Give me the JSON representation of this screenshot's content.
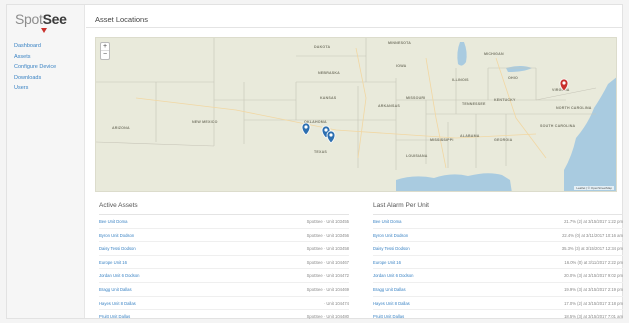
{
  "brand": {
    "name_part1": "Spot",
    "name_part2": "See"
  },
  "sidebar": {
    "items": [
      {
        "label": "Dashboard"
      },
      {
        "label": "Assets"
      },
      {
        "label": "Configure Device"
      },
      {
        "label": "Downloads"
      },
      {
        "label": "Users"
      }
    ]
  },
  "page": {
    "title": "Asset Locations"
  },
  "map": {
    "zoom_in": "+",
    "zoom_out": "−",
    "labels": [
      {
        "text": "DAKOTA"
      },
      {
        "text": "MINNESOTA"
      },
      {
        "text": "MICHIGAN"
      },
      {
        "text": "NEBRASKA"
      },
      {
        "text": "IOWA"
      },
      {
        "text": "ILLINOIS"
      },
      {
        "text": "OHIO"
      },
      {
        "text": "KENTUCKY"
      },
      {
        "text": "VIRGINIA"
      },
      {
        "text": "KANSAS"
      },
      {
        "text": "MISSOURI"
      },
      {
        "text": "OKLAHOMA"
      },
      {
        "text": "ARKANSAS"
      },
      {
        "text": "TENNESSEE"
      },
      {
        "text": "NORTH CAROLINA"
      },
      {
        "text": "SOUTH CAROLINA"
      },
      {
        "text": "NEW MEXICO"
      },
      {
        "text": "ARIZONA"
      },
      {
        "text": "TEXAS"
      },
      {
        "text": "LOUISIANA"
      },
      {
        "text": "MISSISSIPPI"
      },
      {
        "text": "ALABAMA"
      },
      {
        "text": "GEORGIA"
      }
    ],
    "attribution": "Leaflet | © OpenStreetMap"
  },
  "active_assets": {
    "title": "Active Assets",
    "rows": [
      {
        "name": "Bee Unit Doma",
        "value": "SpotSee · Unit 103455"
      },
      {
        "name": "Byron Unit Dodson",
        "value": "SpotSee · Unit 103456"
      },
      {
        "name": "Daisy Tessi Dodson",
        "value": "SpotSee · Unit 103458"
      },
      {
        "name": "Europe Unit 16",
        "value": "SpotSee · Unit 104467"
      },
      {
        "name": "Jordan Unit 6 Dodson",
        "value": "SpotSee · Unit 104472"
      },
      {
        "name": "Bragg Unit Dallas",
        "value": "SpotSee · Unit 104469"
      },
      {
        "name": "Hayes Unit 8 Dallas",
        "value": "· Unit 104474"
      },
      {
        "name": "Pruitt Unit Dallas",
        "value": "SpotSee · Unit 104480"
      }
    ]
  },
  "last_alarm": {
    "title": "Last Alarm Per Unit",
    "rows": [
      {
        "name": "Bee Unit Doma",
        "value": "21.7% (2) at 3/15/2017 1:22 pm"
      },
      {
        "name": "Byron Unit Dodson",
        "value": "22.4% (0) at 3/11/2017 10:16 am"
      },
      {
        "name": "Daisy Tessi Dodson",
        "value": "35.3% (3) at 3/15/2017 12:34 pm"
      },
      {
        "name": "Europe Unit 16",
        "value": "16.0% (0) at 3/11/2017 2:22 pm"
      },
      {
        "name": "Jordan Unit 6 Dodson",
        "value": "20.0% (3) at 3/15/2017 9:02 pm"
      },
      {
        "name": "Bragg Unit Dallas",
        "value": "19.9% (3) at 3/15/2017 2:19 pm"
      },
      {
        "name": "Hayes Unit 8 Dallas",
        "value": "17.0% (2) at 3/15/2017 3:18 pm"
      },
      {
        "name": "Pruitt Unit Dallas",
        "value": "18.5% (3) at 3/15/2017 7:01 am"
      }
    ]
  },
  "colors": {
    "link": "#3a83c4",
    "map_land": "#e9eadb",
    "map_water": "#a9cbe0",
    "asset_marker": "#2d6fb0",
    "alert_marker": "#c9302c"
  }
}
